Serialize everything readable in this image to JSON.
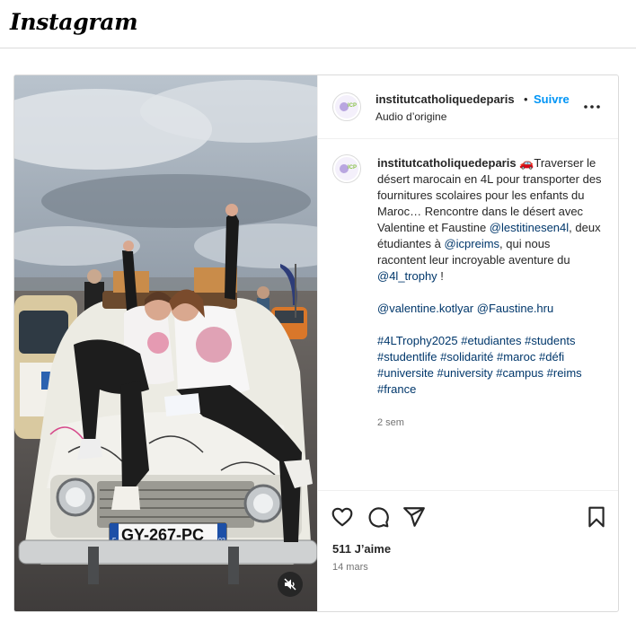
{
  "app": {
    "logo_text": "Instagram"
  },
  "post": {
    "username": "institutcatholiquedeparis",
    "separator": "•",
    "follow_label": "Suivre",
    "audio_label": "Audio d’origine",
    "avatar_text": "ICP",
    "caption": {
      "username": "institutcatholiquedeparis",
      "emoji": "🚗",
      "text_1": "Traverser le désert marocain en 4L pour transporter des fournitures scolaires pour les enfants du Maroc… Rencontre dans le désert avec Valentine et Faustine ",
      "mention_1": "@lestitinesen4l",
      "text_2": ", deux étudiantes à ",
      "mention_2": "@icpreims",
      "text_3": ", qui nous racontent leur incroyable aventure du ",
      "mention_3": "@4l_trophy",
      "text_4": " !",
      "mention_4": "@valentine.kotlyar",
      "mention_5": "@Faustine.hru",
      "hashtags": [
        "#4LTrophy2025",
        "#etudiantes",
        "#students",
        "#studentlife",
        "#solidarité",
        "#maroc",
        "#défi",
        "#universite",
        "#university",
        "#campus",
        "#reims",
        "#france"
      ]
    },
    "caption_age": "2 sem",
    "likes": "511 J’aime",
    "date": "14 mars",
    "media": {
      "license_plate": "GY-267-PC",
      "plate_region": "02",
      "plate_country": "F"
    }
  },
  "icons": {
    "more": "more-options-icon",
    "like": "heart-icon",
    "comment": "comment-icon",
    "share": "share-icon",
    "save": "bookmark-icon",
    "mute": "speaker-muted-icon"
  },
  "colors": {
    "follow": "#0095f6",
    "link": "#00376b",
    "muted_text": "#737373",
    "border": "#dbdbdb"
  }
}
